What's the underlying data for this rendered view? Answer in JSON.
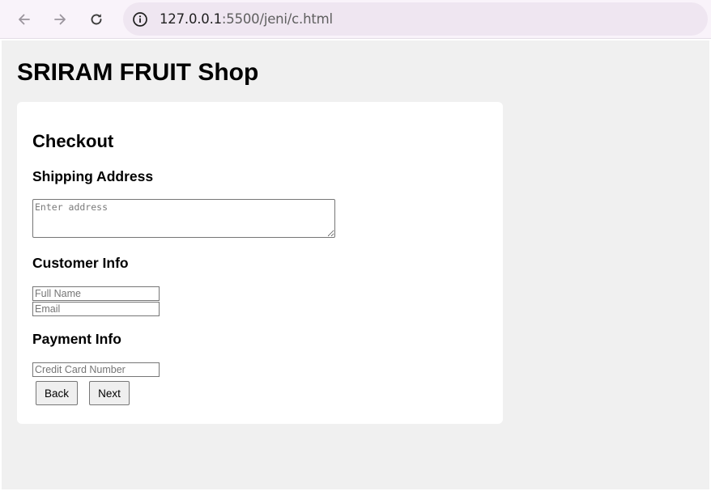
{
  "browser": {
    "url_host": "127.0.0.1",
    "url_path": ":5500/jeni/c.html",
    "icons": {
      "back": "arrow-left-icon",
      "forward": "arrow-right-icon",
      "reload": "reload-icon",
      "site_info": "info-circle-icon"
    }
  },
  "page": {
    "shop_title": "SRIRAM FRUIT Shop",
    "checkout": {
      "heading": "Checkout",
      "shipping": {
        "heading": "Shipping Address",
        "address_placeholder": "Enter address",
        "address_value": ""
      },
      "customer": {
        "heading": "Customer Info",
        "name_placeholder": "Full Name",
        "name_value": "",
        "email_placeholder": "Email",
        "email_value": ""
      },
      "payment": {
        "heading": "Payment Info",
        "card_placeholder": "Credit Card Number",
        "card_value": ""
      },
      "buttons": {
        "back_label": "Back",
        "next_label": "Next"
      }
    }
  },
  "colors": {
    "chrome_background": "#f9f3fa",
    "address_bar_background": "#efe6f1",
    "page_background": "#f0f0f0",
    "card_background": "#ffffff"
  }
}
